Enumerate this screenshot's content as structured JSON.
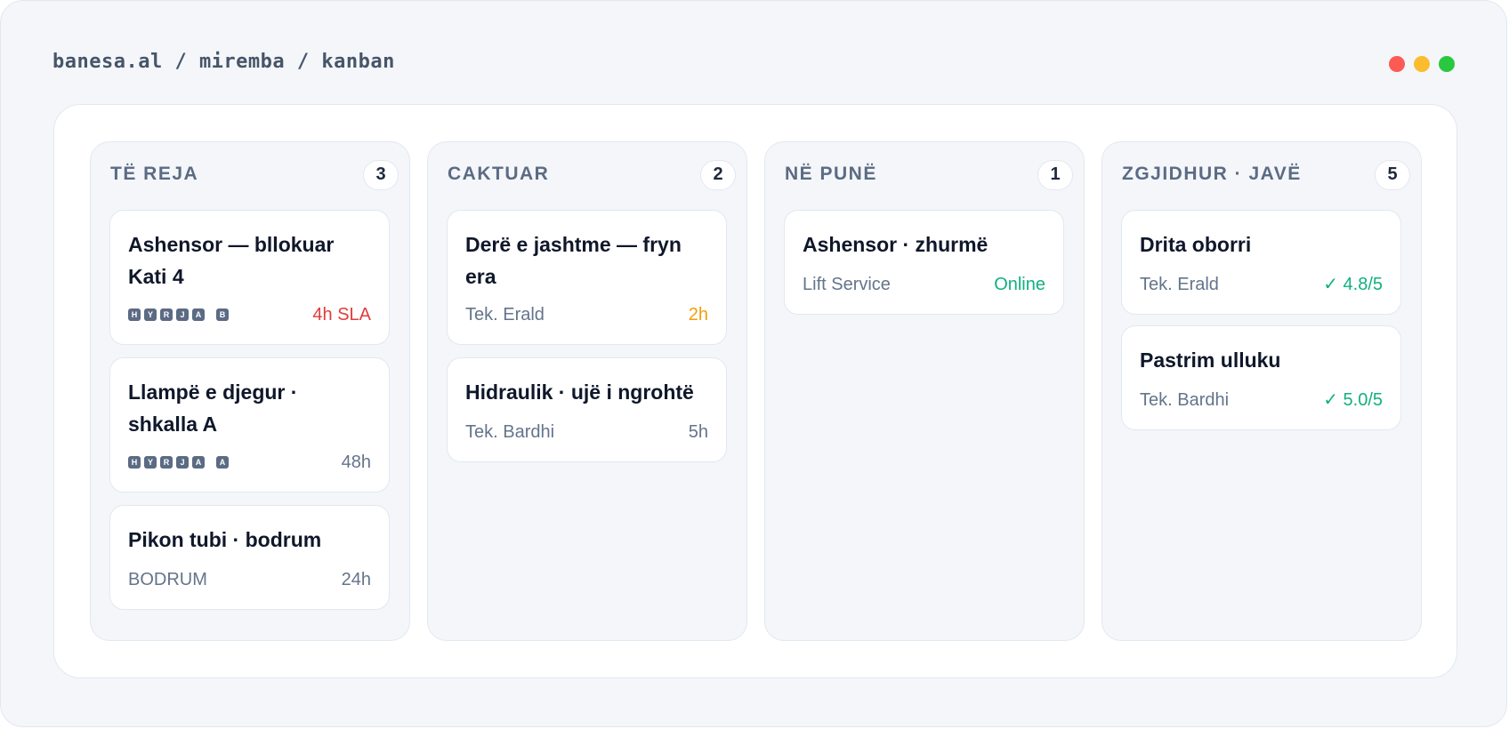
{
  "breadcrumb": "banesa.al / miremba / kanban",
  "window_controls": {
    "close_color": "#fb5a55",
    "minimize_color": "#fbbd2e",
    "maximize_color": "#2ac840"
  },
  "columns": [
    {
      "title": "TË REJA",
      "count": "3",
      "cards": [
        {
          "title": "Ashensor — bllokuar Kati 4",
          "keys": [
            "H",
            "Y",
            "R",
            "J",
            "A",
            "B"
          ],
          "meta_right": "4h SLA",
          "meta_right_color": "red"
        },
        {
          "title": "Llampë e djegur · shkalla A",
          "keys": [
            "H",
            "Y",
            "R",
            "J",
            "A",
            "A"
          ],
          "meta_right": "48h"
        },
        {
          "title": "Pikon tubi · bodrum",
          "meta_left": "BODRUM",
          "meta_right": "24h"
        }
      ]
    },
    {
      "title": "CAKTUAR",
      "count": "2",
      "cards": [
        {
          "title": "Derë e jashtme — fryn era",
          "meta_left": "Tek. Erald",
          "meta_right": "2h",
          "meta_right_color": "amber"
        },
        {
          "title": "Hidraulik · ujë i ngrohtë",
          "meta_left": "Tek. Bardhi",
          "meta_right": "5h"
        }
      ]
    },
    {
      "title": "NË PUNË",
      "count": "1",
      "cards": [
        {
          "title": "Ashensor · zhurmë",
          "meta_left": "Lift Service",
          "meta_right": "Online",
          "meta_right_color": "green"
        }
      ]
    },
    {
      "title": "ZGJIDHUR · JAVË",
      "count": "5",
      "cards": [
        {
          "title": "Drita oborri",
          "meta_left": "Tek. Erald",
          "meta_right": "✓ 4.8/5",
          "meta_right_color": "green"
        },
        {
          "title": "Pastrim ulluku",
          "meta_left": "Tek. Bardhi",
          "meta_right": "✓ 5.0/5",
          "meta_right_color": "green"
        }
      ]
    }
  ]
}
